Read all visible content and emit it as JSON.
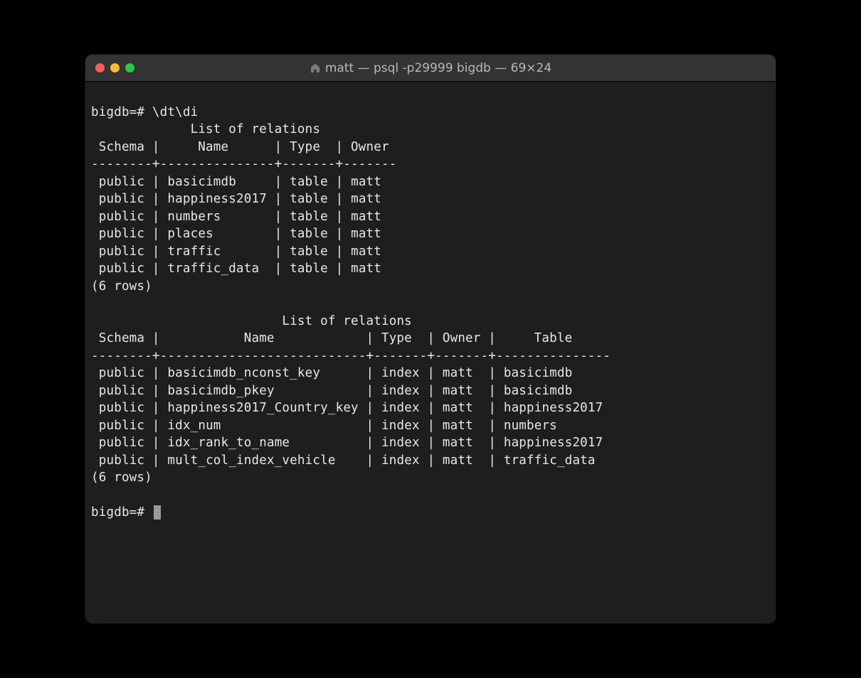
{
  "window": {
    "title": "matt — psql -p29999 bigdb — 69×24"
  },
  "terminal": {
    "prompt": "bigdb=#",
    "command": "\\dt\\di",
    "section1": {
      "title": "List of relations",
      "headers": [
        "Schema",
        "Name",
        "Type",
        "Owner"
      ],
      "rows": [
        {
          "schema": "public",
          "name": "basicimdb",
          "type": "table",
          "owner": "matt"
        },
        {
          "schema": "public",
          "name": "happiness2017",
          "type": "table",
          "owner": "matt"
        },
        {
          "schema": "public",
          "name": "numbers",
          "type": "table",
          "owner": "matt"
        },
        {
          "schema": "public",
          "name": "places",
          "type": "table",
          "owner": "matt"
        },
        {
          "schema": "public",
          "name": "traffic",
          "type": "table",
          "owner": "matt"
        },
        {
          "schema": "public",
          "name": "traffic_data",
          "type": "table",
          "owner": "matt"
        }
      ],
      "footer": "(6 rows)"
    },
    "section2": {
      "title": "List of relations",
      "headers": [
        "Schema",
        "Name",
        "Type",
        "Owner",
        "Table"
      ],
      "rows": [
        {
          "schema": "public",
          "name": "basicimdb_nconst_key",
          "type": "index",
          "owner": "matt",
          "table": "basicimdb"
        },
        {
          "schema": "public",
          "name": "basicimdb_pkey",
          "type": "index",
          "owner": "matt",
          "table": "basicimdb"
        },
        {
          "schema": "public",
          "name": "happiness2017_Country_key",
          "type": "index",
          "owner": "matt",
          "table": "happiness2017"
        },
        {
          "schema": "public",
          "name": "idx_num",
          "type": "index",
          "owner": "matt",
          "table": "numbers"
        },
        {
          "schema": "public",
          "name": "idx_rank_to_name",
          "type": "index",
          "owner": "matt",
          "table": "happiness2017"
        },
        {
          "schema": "public",
          "name": "mult_col_index_vehicle",
          "type": "index",
          "owner": "matt",
          "table": "traffic_data"
        }
      ],
      "footer": "(6 rows)"
    }
  }
}
